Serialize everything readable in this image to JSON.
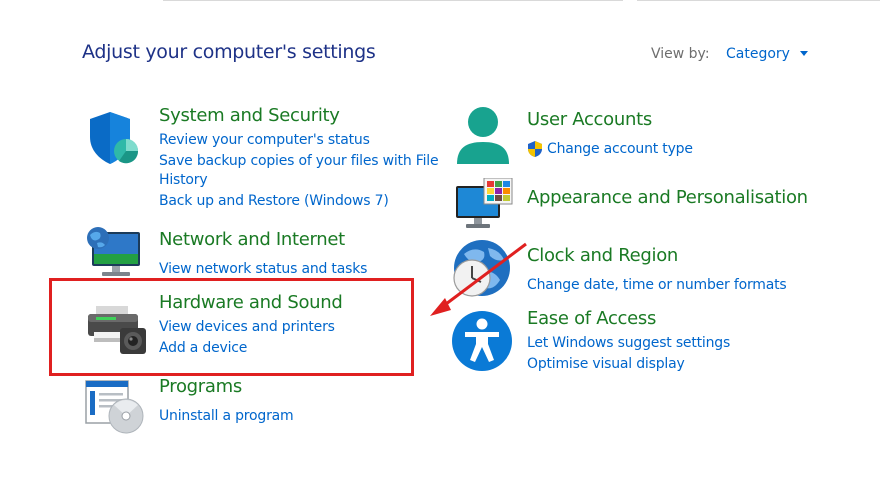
{
  "page": {
    "title": "Adjust your computer's settings",
    "view_by_label": "View by:",
    "view_by_value": "Category"
  },
  "categories": {
    "system_security": {
      "title": "System and Security",
      "links": [
        "Review your computer's status",
        "Save backup copies of your files with File",
        "History",
        "Back up and Restore (Windows 7)"
      ]
    },
    "network": {
      "title": "Network and Internet",
      "links": [
        "View network status and tasks"
      ]
    },
    "hardware": {
      "title": "Hardware and Sound",
      "links": [
        "View devices and printers",
        "Add a device"
      ]
    },
    "programs": {
      "title": "Programs",
      "links": [
        "Uninstall a program"
      ]
    },
    "user_accounts": {
      "title": "User Accounts",
      "links": [
        "Change account type"
      ]
    },
    "appearance": {
      "title": "Appearance and Personalisation",
      "links": []
    },
    "clock": {
      "title": "Clock and Region",
      "links": [
        "Change date, time or number formats"
      ]
    },
    "ease": {
      "title": "Ease of Access",
      "links": [
        "Let Windows suggest settings",
        "Optimise visual display"
      ]
    }
  },
  "annotation": {
    "color": "#e02020"
  },
  "colors": {
    "heading": "#1a7a24",
    "link": "#0066cc",
    "title": "#1e3287"
  }
}
